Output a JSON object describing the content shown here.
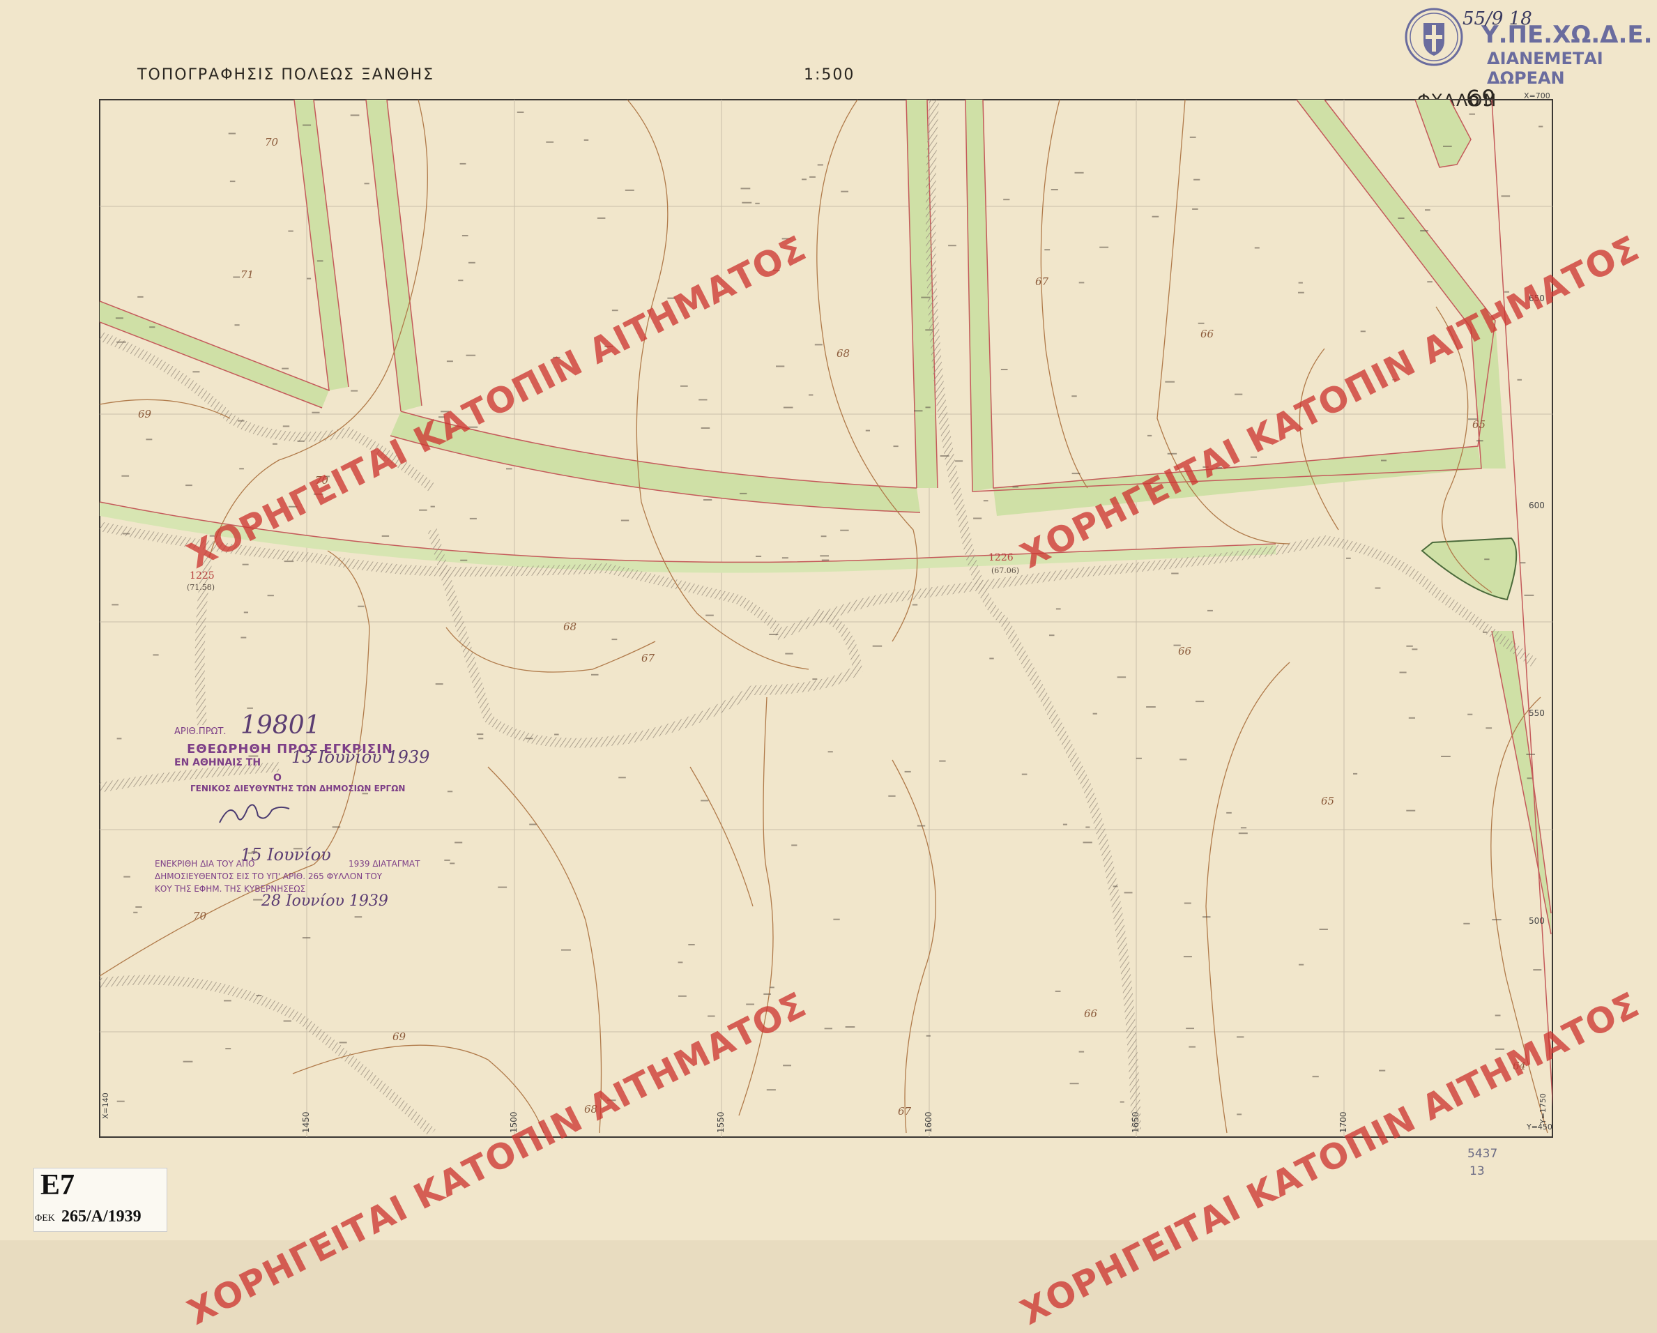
{
  "header": {
    "left_title": "ΤΟΠΟΓΡΑΦΗΣΙΣ ΠΟΛΕΩΣ ΞΑΝΘΗΣ",
    "scale": "1:500",
    "sheet_label": "ΦΥΛΛΟΝ",
    "sheet_number": "69"
  },
  "agency": {
    "name": "Υ.ΠΕ.ΧΩ.Δ.Ε.",
    "note": "ΔΙΑΝΕΜΕΤΑΙ ΔΩΡΕΑΝ",
    "handwritten": "55/9 18"
  },
  "watermark": {
    "text": "ΧΟΡΗΓΕΙΤΑΙ ΚΑΤΟΠΙΝ ΑΙΤΗΜΑΤΟΣ"
  },
  "approval_stamp": {
    "number_prefix": "ΑΡΙΘ.ΠΡΩΤ.",
    "number": "19801",
    "line1": "ΕΘΕΩΡΗΘΗ ΠΡΟΣ ΕΓΚΡΙΣΙΝ",
    "line2_prefix": "ΕΝ ΑΘΗΝΑΙΣ ΤΗ",
    "date_hand": "13 Ιουνίου 1939",
    "line3": "Ο",
    "line4": "ΓΕΝΙΚΟΣ ΔΙΕΥΘΥΝΤΗΣ ΤΩΝ ΔΗΜΟΣΙΩΝ ΕΡΓΩΝ"
  },
  "approval_decree": {
    "line1_prefix": "ΕΝΕΚΡΙΘΗ ΔΙΑ ΤΟΥ ΑΠΟ",
    "line1_date": "15 Ιουνίου",
    "line1_suffix": "1939 ΔΙΑΤΑΓΜΑΤ",
    "line2": "ΔΗΜΟΣΙΕΥΘΕΝΤΟΣ ΕΙΣ ΤΟ ΥΠ' ΑΡΙΘ. 265 ΦΥΛΛΟΝ ΤΟΥ",
    "line3": "ΚΟΥ ΤΗΣ ΕΦΗΜ. ΤΗΣ ΚΥΒΕΡΝΗΣΕΩΣ",
    "line4_date": "28 Ιουνίου 1939"
  },
  "gazette_code": {
    "code": "E7",
    "ref_prefix": "ΦΕΚ",
    "ref": "265/A/1939"
  },
  "pencil_notes": {
    "n1": "5437",
    "n2": "13"
  },
  "grid": {
    "bottom_labels": [
      "X=140",
      "1450",
      "1500",
      "1550",
      "1600",
      "1650",
      "1700",
      "Y=1750"
    ],
    "right_labels": [
      "X=700",
      "650",
      "600",
      "550",
      "500",
      "Y=450"
    ]
  },
  "contours": {
    "labels": [
      "70",
      "71",
      "70",
      "70",
      "69",
      "68",
      "68",
      "67",
      "67",
      "66",
      "66",
      "65",
      "65",
      "64",
      "69",
      "68",
      "67",
      "66"
    ]
  },
  "survey_marks": {
    "mark1": "1225",
    "mark1_sub": "(71.58)",
    "mark2": "1226",
    "mark2_sub": "(67.06)"
  },
  "colors": {
    "paper": "#f1e6cb",
    "road_fill": "#cfe0a6",
    "road_edge": "#c45a5a",
    "contour": "#b07a4a",
    "watermark": "#cd3732",
    "stamp": "#7d3f87"
  }
}
